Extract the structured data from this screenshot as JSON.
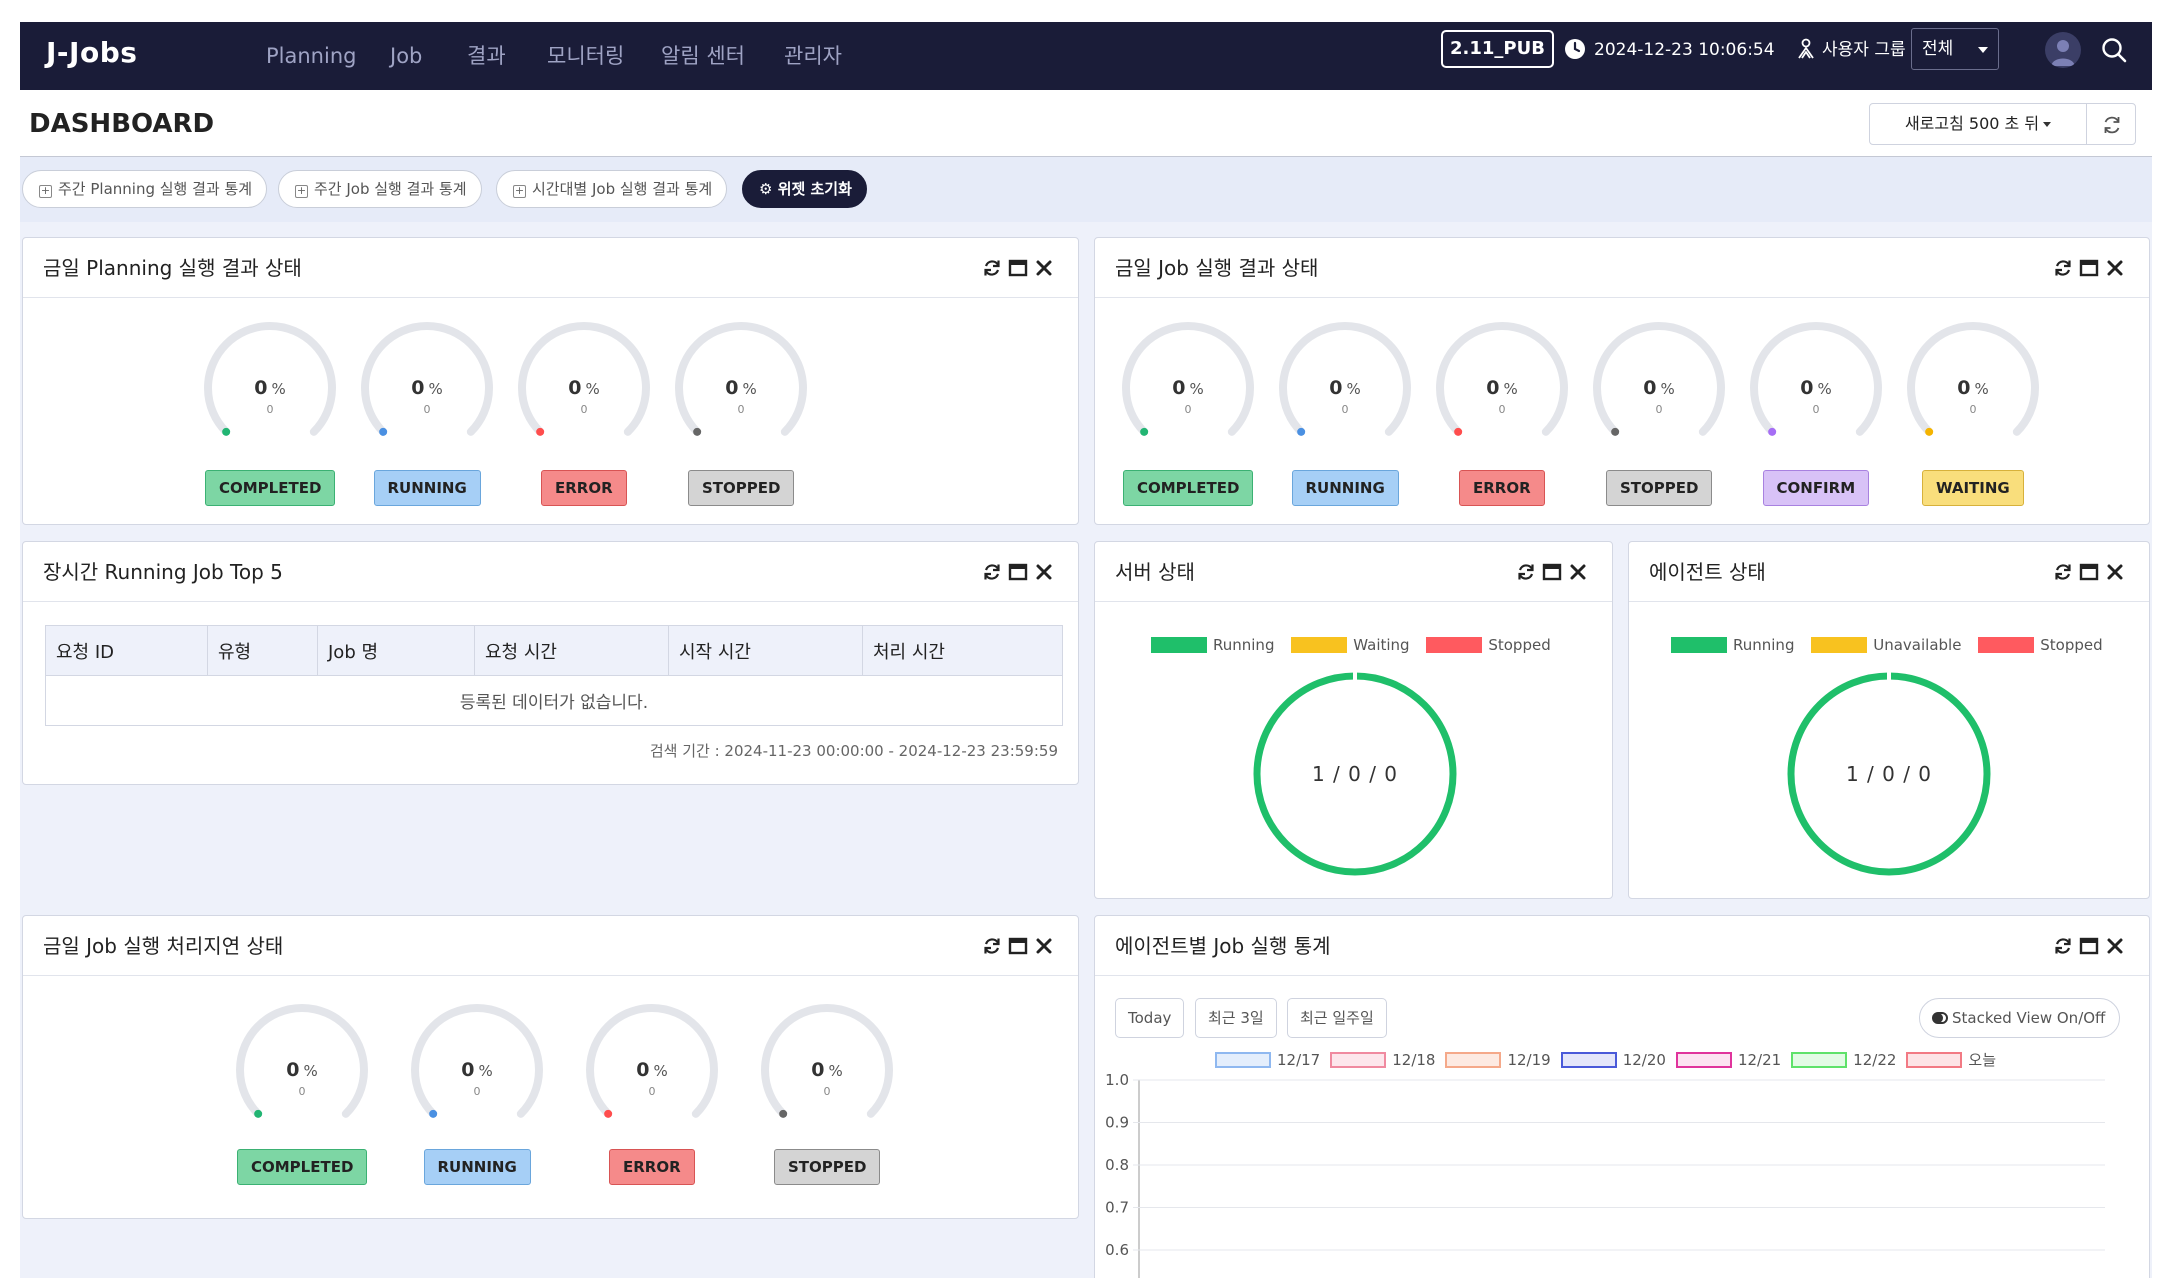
{
  "topbar": {
    "logo": "J-Jobs",
    "nav": [
      "Planning",
      "Job",
      "결과",
      "모니터링",
      "알림 센터",
      "관리자"
    ],
    "version": "2.11_PUB",
    "datetime": "2024-12-23 10:06:54",
    "usergroup_label": "사용자 그룹",
    "group_value": "전체"
  },
  "header": {
    "title": "DASHBOARD",
    "refresh_label": "새로고침 500 초 뒤"
  },
  "chips": {
    "weekly_planning": "주간 Planning 실행 결과 통계",
    "weekly_job": "주간 Job 실행 결과 통계",
    "hourly_job": "시간대별 Job 실행 결과 통계",
    "reset": "위젯 초기화"
  },
  "planning_status": {
    "title": "금일 Planning 실행 결과 상태",
    "gauges": [
      {
        "value": "0",
        "unit": "%",
        "sub": "0",
        "label": "COMPLETED",
        "color": "#22b573"
      },
      {
        "value": "0",
        "unit": "%",
        "sub": "0",
        "label": "RUNNING",
        "color": "#4a90e2"
      },
      {
        "value": "0",
        "unit": "%",
        "sub": "0",
        "label": "ERROR",
        "color": "#ff4d4d"
      },
      {
        "value": "0",
        "unit": "%",
        "sub": "0",
        "label": "STOPPED",
        "color": "#666666"
      }
    ]
  },
  "job_status": {
    "title": "금일 Job 실행 결과 상태",
    "gauges": [
      {
        "value": "0",
        "unit": "%",
        "sub": "0",
        "label": "COMPLETED",
        "color": "#22b573"
      },
      {
        "value": "0",
        "unit": "%",
        "sub": "0",
        "label": "RUNNING",
        "color": "#4a90e2"
      },
      {
        "value": "0",
        "unit": "%",
        "sub": "0",
        "label": "ERROR",
        "color": "#ff4d4d"
      },
      {
        "value": "0",
        "unit": "%",
        "sub": "0",
        "label": "STOPPED",
        "color": "#666666"
      },
      {
        "value": "0",
        "unit": "%",
        "sub": "0",
        "label": "CONFIRM",
        "color": "#a66ef5"
      },
      {
        "value": "0",
        "unit": "%",
        "sub": "0",
        "label": "WAITING",
        "color": "#f5b400"
      }
    ]
  },
  "long_running": {
    "title": "장시간 Running Job Top 5",
    "columns": [
      "요청 ID",
      "유형",
      "Job 명",
      "요청 시간",
      "시작 시간",
      "처리 시간"
    ],
    "empty_text": "등록된 데이터가 없습니다.",
    "search_period": "검색 기간 : 2024-11-23 00:00:00 - 2024-12-23 23:59:59"
  },
  "server_status": {
    "title": "서버 상태",
    "legend": [
      {
        "label": "Running",
        "color": "#1fbf6a"
      },
      {
        "label": "Waiting",
        "color": "#f8c21f"
      },
      {
        "label": "Stopped",
        "color": "#ff5a5f"
      }
    ],
    "center_text": "1 / 0 / 0",
    "counts": {
      "running": 1,
      "waiting": 0,
      "stopped": 0
    }
  },
  "agent_status": {
    "title": "에이전트 상태",
    "legend": [
      {
        "label": "Running",
        "color": "#1fbf6a"
      },
      {
        "label": "Unavailable",
        "color": "#f8c21f"
      },
      {
        "label": "Stopped",
        "color": "#ff5a5f"
      }
    ],
    "center_text": "1 / 0 / 0",
    "counts": {
      "running": 1,
      "unavailable": 0,
      "stopped": 0
    }
  },
  "delay_status": {
    "title": "금일 Job 실행 처리지연 상태",
    "gauges": [
      {
        "value": "0",
        "unit": "%",
        "sub": "0",
        "label": "COMPLETED",
        "color": "#22b573"
      },
      {
        "value": "0",
        "unit": "%",
        "sub": "0",
        "label": "RUNNING",
        "color": "#4a90e2"
      },
      {
        "value": "0",
        "unit": "%",
        "sub": "0",
        "label": "ERROR",
        "color": "#ff4d4d"
      },
      {
        "value": "0",
        "unit": "%",
        "sub": "0",
        "label": "STOPPED",
        "color": "#666666"
      }
    ]
  },
  "agent_job_stats": {
    "title": "에이전트별 Job 실행 통계",
    "ranges": [
      "Today",
      "최근 3일",
      "최근 일주일"
    ],
    "stack_toggle": "Stacked View On/Off"
  },
  "chart_data": {
    "type": "bar",
    "series": [
      {
        "name": "12/17",
        "color": "#8fb8f0",
        "fill": "#e4eefc",
        "values": []
      },
      {
        "name": "12/18",
        "color": "#f08aa0",
        "fill": "#fde6ec",
        "values": []
      },
      {
        "name": "12/19",
        "color": "#f5a98a",
        "fill": "#fdeae2",
        "values": []
      },
      {
        "name": "12/20",
        "color": "#4a5ad9",
        "fill": "#e4e6fa",
        "values": []
      },
      {
        "name": "12/21",
        "color": "#e0349c",
        "fill": "#fce3f1",
        "values": []
      },
      {
        "name": "12/22",
        "color": "#5fe26a",
        "fill": "#e3fbe5",
        "values": []
      },
      {
        "name": "오늘",
        "color": "#f27a84",
        "fill": "#fde4e6",
        "values": []
      }
    ],
    "yticks": [
      "1.0",
      "0.9",
      "0.8",
      "0.7",
      "0.6"
    ],
    "ylim": [
      0.6,
      1.0
    ],
    "grid": true,
    "legend": "top"
  }
}
